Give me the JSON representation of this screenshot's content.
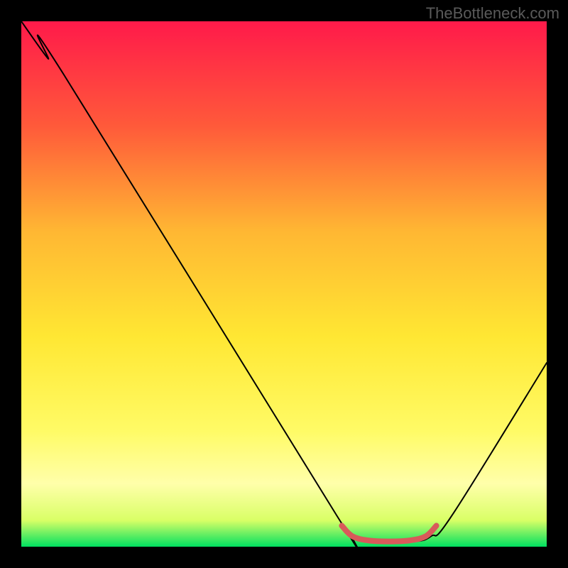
{
  "watermark": "TheBottleneck.com",
  "chart_data": {
    "type": "line",
    "title": "",
    "xlabel": "",
    "ylabel": "",
    "xlim": [
      0,
      100
    ],
    "ylim": [
      0,
      100
    ],
    "background": {
      "type": "vertical-gradient",
      "stops": [
        {
          "offset": 0,
          "color": "#ff1a4a"
        },
        {
          "offset": 20,
          "color": "#ff5a3a"
        },
        {
          "offset": 40,
          "color": "#ffb733"
        },
        {
          "offset": 60,
          "color": "#ffe733"
        },
        {
          "offset": 78,
          "color": "#fffb66"
        },
        {
          "offset": 88,
          "color": "#ffffaa"
        },
        {
          "offset": 95,
          "color": "#d9ff66"
        },
        {
          "offset": 100,
          "color": "#00e060"
        }
      ]
    },
    "series": [
      {
        "name": "curve",
        "color": "#000000",
        "width": 2,
        "points": [
          {
            "x": 0,
            "y": 100
          },
          {
            "x": 5,
            "y": 93
          },
          {
            "x": 8,
            "y": 90
          },
          {
            "x": 60,
            "y": 6
          },
          {
            "x": 63,
            "y": 2
          },
          {
            "x": 66,
            "y": 1
          },
          {
            "x": 70,
            "y": 1
          },
          {
            "x": 75,
            "y": 1
          },
          {
            "x": 78,
            "y": 2
          },
          {
            "x": 82,
            "y": 6
          },
          {
            "x": 100,
            "y": 35
          }
        ]
      },
      {
        "name": "highlight-flat",
        "color": "#d85a5a",
        "width": 8,
        "points": [
          {
            "x": 61,
            "y": 4
          },
          {
            "x": 63,
            "y": 2
          },
          {
            "x": 66,
            "y": 1.2
          },
          {
            "x": 70,
            "y": 1
          },
          {
            "x": 74,
            "y": 1.2
          },
          {
            "x": 77,
            "y": 2
          },
          {
            "x": 79,
            "y": 4
          }
        ]
      }
    ]
  }
}
